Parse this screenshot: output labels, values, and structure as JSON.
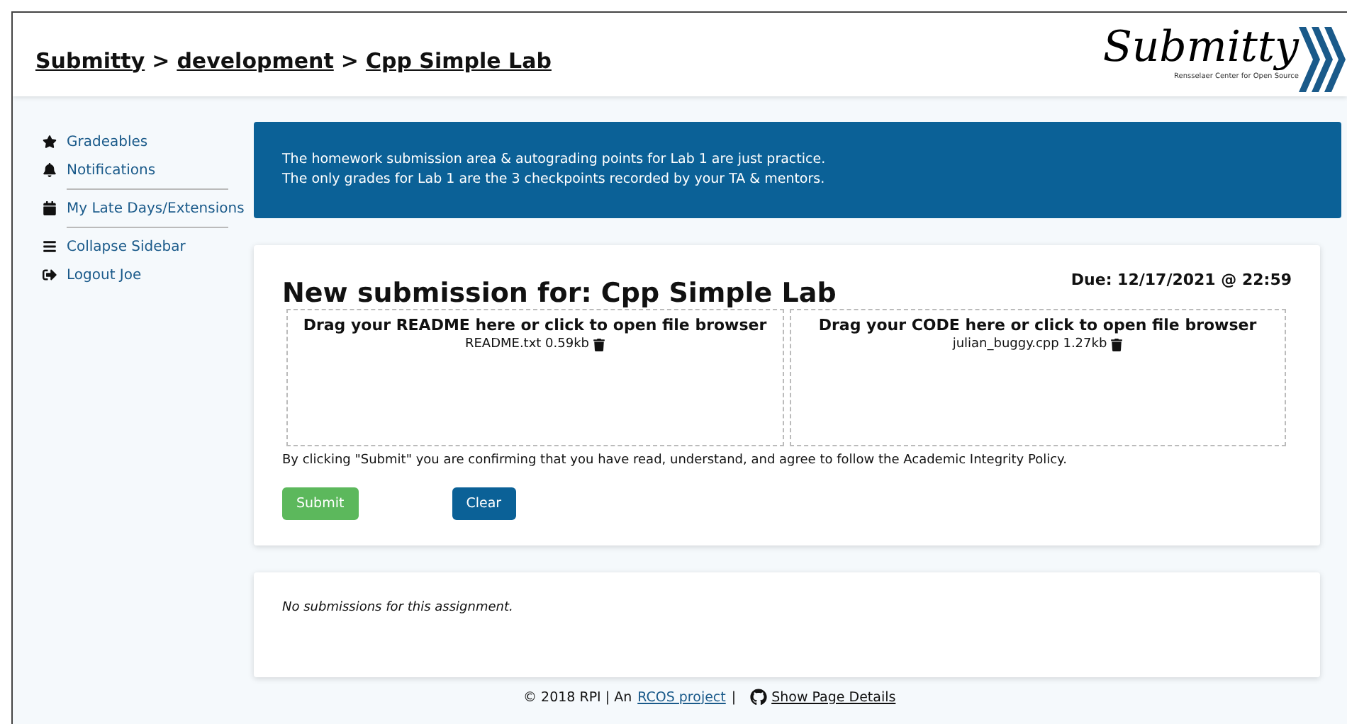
{
  "breadcrumb": [
    {
      "label": "Submitty"
    },
    {
      "label": "development"
    },
    {
      "label": "Cpp Simple Lab"
    }
  ],
  "breadcrumb_separator": ">",
  "logo": {
    "title": "Submitty",
    "subtitle": "Rensselaer Center for Open Source"
  },
  "sidebar": {
    "groups": [
      [
        {
          "label": "Gradeables",
          "kind": "star"
        },
        {
          "label": "Notifications",
          "kind": "bell"
        }
      ],
      [
        {
          "label": "My Late Days/Extensions",
          "kind": "calendar"
        }
      ],
      [
        {
          "label": "Collapse Sidebar",
          "kind": "menu"
        },
        {
          "label": "Logout Joe",
          "kind": "logout"
        }
      ]
    ]
  },
  "banner": [
    "The homework submission area & autograding points for Lab 1 are just practice.",
    "The only grades for Lab 1 are the 3 checkpoints recorded by your TA & mentors."
  ],
  "submission": {
    "title": "New submission for: Cpp Simple Lab",
    "due": "Due: 12/17/2021 @ 22:59",
    "dropzones": [
      {
        "label": "Drag your README here or click to open file browser",
        "file": "README.txt 0.59kb"
      },
      {
        "label": "Drag your CODE here or click to open file browser",
        "file": "julian_buggy.cpp 1.27kb"
      }
    ],
    "notice": "By clicking \"Submit\" you are confirming that you have read, understand, and agree to follow the Academic Integrity Policy.",
    "buttons": [
      {
        "label": "Submit",
        "kind": "submit"
      },
      {
        "label": "Clear",
        "kind": "clear"
      }
    ]
  },
  "history": {
    "message": "No submissions for this assignment."
  },
  "footer": {
    "copyright": "© 2018 RPI | An",
    "link": "RCOS project",
    "separator": "|",
    "details": "Show Page Details"
  }
}
